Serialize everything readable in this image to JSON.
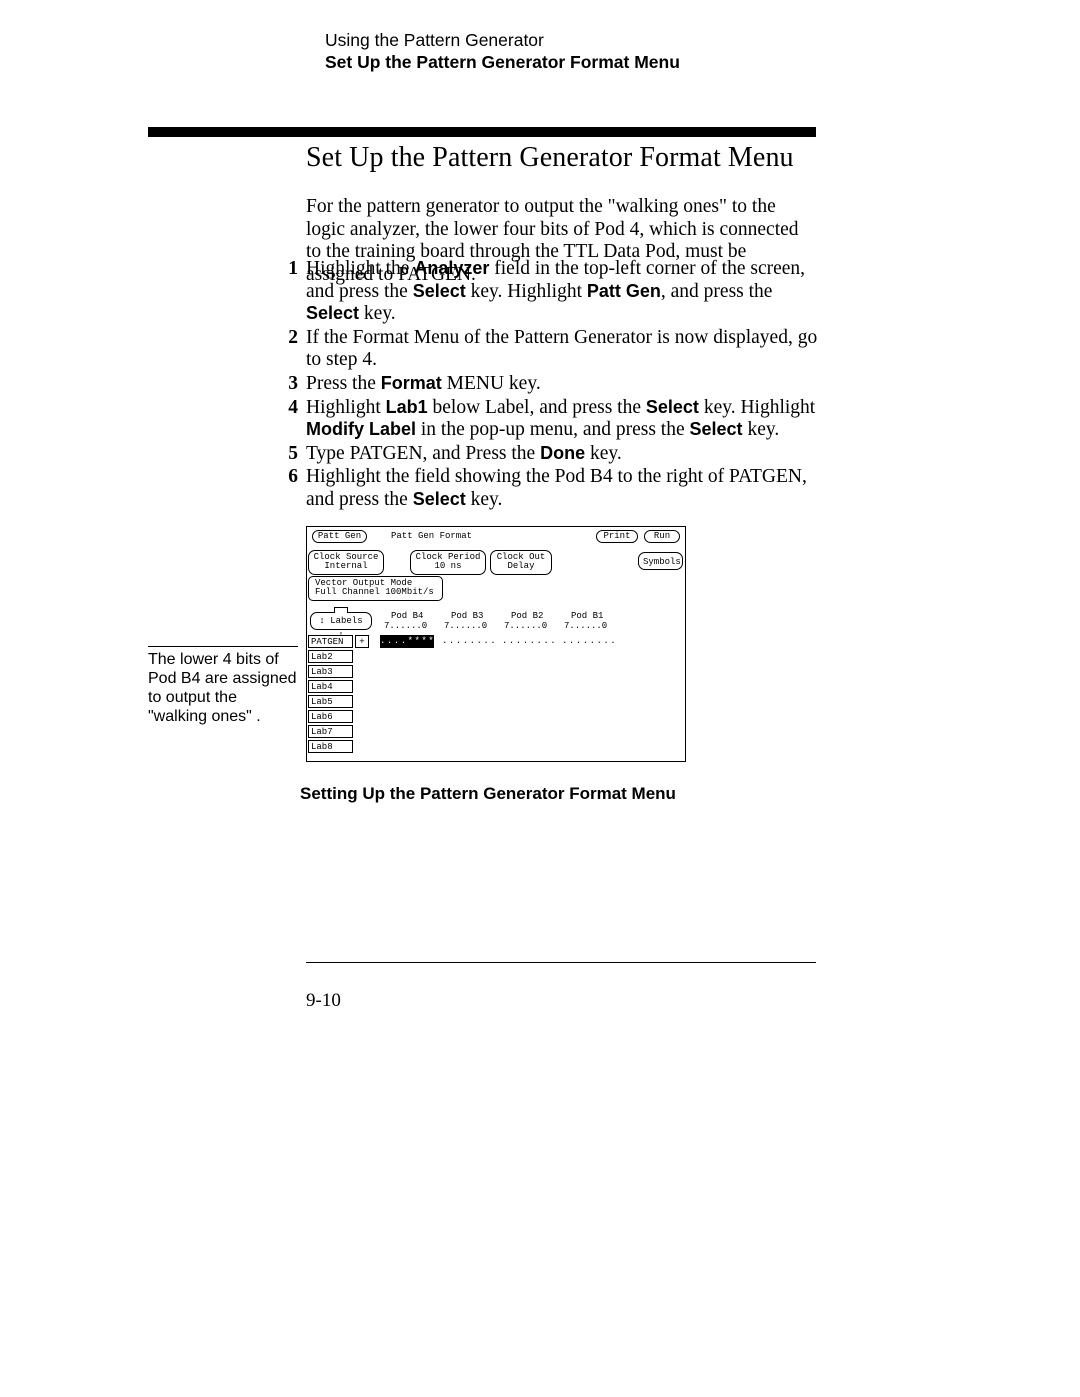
{
  "running_head": {
    "line1": "Using the Pattern Generator",
    "line2": "Set Up the Pattern Generator Format Menu"
  },
  "heading": "Set Up the Pattern Generator Format Menu",
  "intro": "For the pattern generator to output the \"walking ones\" to the logic analyzer, the lower four bits of Pod 4, which is connected to the training board through the TTL Data Pod, must be assigned to PATGEN.",
  "steps": [
    {
      "n": "1",
      "pre": "Highlight the ",
      "b1": "Analyzer",
      "mid1": " field in the top-left corner of the screen, and press the ",
      "b2": "Select",
      "mid2": " key.  Highlight ",
      "b3": "Patt Gen",
      "mid3": ", and press the ",
      "b4": "Select",
      "tail": " key."
    },
    {
      "n": "2",
      "pre": "If the Format Menu of the Pattern Generator is now displayed, go to step 4.",
      "b1": "",
      "mid1": "",
      "b2": "",
      "mid2": "",
      "b3": "",
      "mid3": "",
      "b4": "",
      "tail": ""
    },
    {
      "n": "3",
      "pre": "Press the ",
      "b1": "Format",
      "mid1": " MENU key.",
      "b2": "",
      "mid2": "",
      "b3": "",
      "mid3": "",
      "b4": "",
      "tail": ""
    },
    {
      "n": "4",
      "pre": "Highlight ",
      "b1": "Lab1",
      "mid1": " below Label, and press the ",
      "b2": "Select",
      "mid2": " key.  Highlight ",
      "b3": "Modify Label",
      "mid3": " in the pop-up menu, and press the ",
      "b4": "Select",
      "tail": " key."
    },
    {
      "n": "5",
      "pre": "Type PATGEN, and Press the ",
      "b1": "Done",
      "mid1": " key.",
      "b2": "",
      "mid2": "",
      "b3": "",
      "mid3": "",
      "b4": "",
      "tail": ""
    },
    {
      "n": "6",
      "pre": "Highlight the field showing the Pod B4 to the right of PATGEN, and press the ",
      "b1": "Select",
      "mid1": " key.",
      "b2": "",
      "mid2": "",
      "b3": "",
      "mid3": "",
      "b4": "",
      "tail": ""
    }
  ],
  "side_label": "The lower 4 bits of Pod B4 are assigned to output the \"walking ones\" .",
  "figure": {
    "patt_gen": "Patt Gen",
    "patt_gen_format": "Patt Gen Format",
    "print": "Print",
    "run": "Run",
    "clock_source_label": "Clock Source",
    "clock_source_value": "Internal",
    "clock_period_label": "Clock Period",
    "clock_period_value": "10 ns",
    "clock_out_label": "Clock Out",
    "clock_out_value": "Delay",
    "symbols": "Symbols",
    "vector_mode_line1": "Vector Output Mode",
    "vector_mode_line2": "Full Channel 100Mbit/s",
    "labels": "↕ Labels ↕",
    "pods": [
      "Pod B4",
      "Pod B3",
      "Pod B2",
      "Pod B1"
    ],
    "pod_scale": "7......0",
    "row_labels": [
      "PATGEN",
      "Lab2",
      "Lab3",
      "Lab4",
      "Lab5",
      "Lab6",
      "Lab7",
      "Lab8"
    ],
    "plus": "+",
    "b4_assign": "....****",
    "other_assign": "........"
  },
  "figure_caption": "Setting Up the Pattern Generator Format Menu",
  "page_number": "9-10"
}
